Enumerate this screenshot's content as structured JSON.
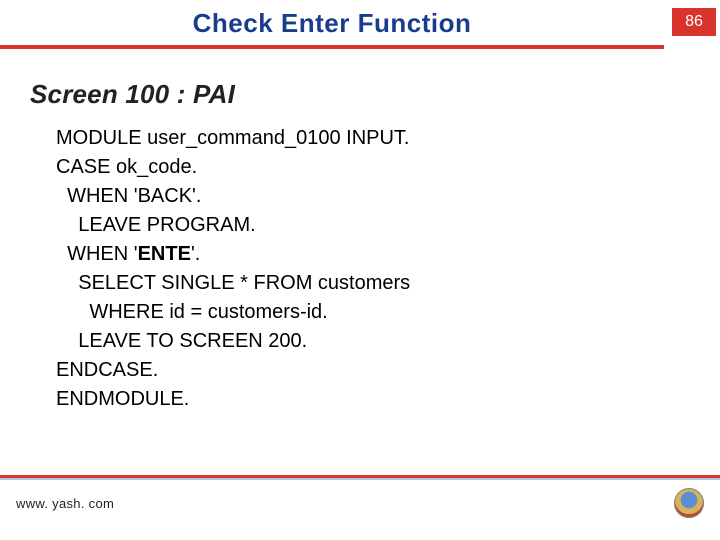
{
  "header": {
    "title": "Check Enter Function",
    "page_number": "86"
  },
  "subheading": "Screen 100 : PAI",
  "code": {
    "l1": "MODULE user_command_0100 INPUT.",
    "l2": "CASE ok_code.",
    "l3": "  WHEN 'BACK'.",
    "l4": "    LEAVE PROGRAM.",
    "l5a": "  WHEN '",
    "l5b": "ENTE",
    "l5c": "'.",
    "l6": "    SELECT SINGLE * FROM customers",
    "l7": "      WHERE id = customers-id.",
    "l8": "    LEAVE TO SCREEN 200.",
    "l9": "ENDCASE.",
    "l10": "ENDMODULE."
  },
  "footer": {
    "url": "www. yash. com"
  }
}
